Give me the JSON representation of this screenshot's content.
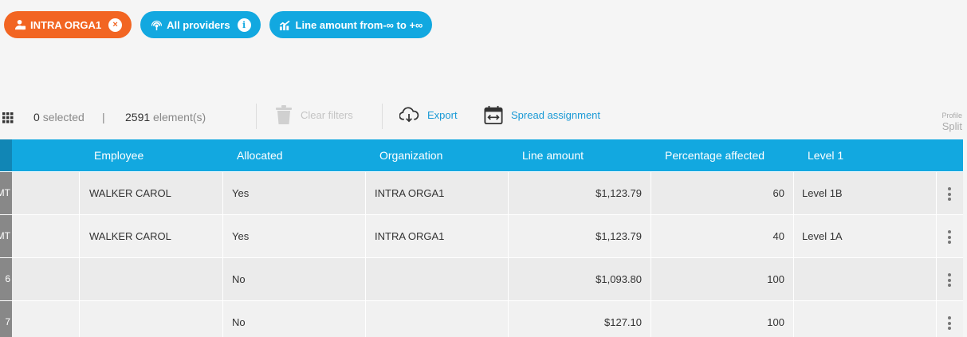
{
  "filters": [
    {
      "label": "INTRA ORGA1",
      "icon": "org-person-icon",
      "trail": "×",
      "trail_icon": "remove-filter-icon",
      "color": "#f26522"
    },
    {
      "label": "All providers",
      "icon": "providers-icon",
      "trail": "i",
      "trail_icon": "info-icon",
      "color": "#12a8e0"
    },
    {
      "label_prefix": "Line amount from ",
      "from": "-∞",
      "to_word": " to ",
      "to": "+∞",
      "icon": "chart-icon",
      "color": "#12a8e0"
    }
  ],
  "toolbar": {
    "selected_count": "0",
    "selected_label": "selected",
    "separator": "|",
    "element_count": "2591",
    "element_label": "element(s)",
    "clear_filters": "Clear filters",
    "export": "Export",
    "spread_assignment": "Spread assignment",
    "profile_label": "Profile",
    "profile_value": "Split"
  },
  "table": {
    "columns": [
      "Employee",
      "Allocated",
      "Organization",
      "Line amount",
      "Percentage affected",
      "Level 1"
    ],
    "rows": [
      {
        "stub": "MT",
        "employee": "WALKER CAROL",
        "allocated": "Yes",
        "organization": "INTRA ORGA1",
        "line_amount": "$1,123.79",
        "percentage": "60",
        "level1": "Level 1B"
      },
      {
        "stub": "MT",
        "employee": "WALKER CAROL",
        "allocated": "Yes",
        "organization": "INTRA ORGA1",
        "line_amount": "$1,123.79",
        "percentage": "40",
        "level1": "Level 1A"
      },
      {
        "stub": "6",
        "employee": "",
        "allocated": "No",
        "organization": "",
        "line_amount": "$1,093.80",
        "percentage": "100",
        "level1": ""
      },
      {
        "stub": "7",
        "employee": "",
        "allocated": "No",
        "organization": "",
        "line_amount": "$127.10",
        "percentage": "100",
        "level1": ""
      }
    ]
  },
  "colors": {
    "accent": "#12a8e0",
    "filter_orange": "#f26522",
    "link": "#1a9ad6"
  }
}
